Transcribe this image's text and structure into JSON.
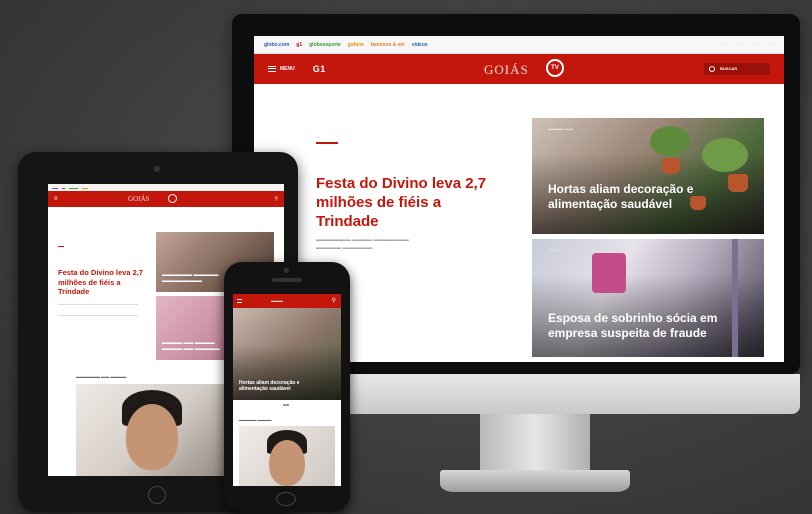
{
  "desktop": {
    "topbar": {
      "links": [
        {
          "label": "globo.com",
          "color": "#2b5fb3"
        },
        {
          "label": "g1",
          "color": "#c4170c"
        },
        {
          "label": "globoesporte",
          "color": "#3a9b2d"
        },
        {
          "label": "gshow",
          "color": "#f28b00"
        },
        {
          "label": "famosos & etc",
          "color": "#e67e22"
        },
        {
          "label": "vídeos",
          "color": "#2b5fb3"
        }
      ]
    },
    "header": {
      "menu_label": "MENU",
      "logo": "G1",
      "region": "GOIÁS",
      "tv_logo": "TV",
      "search_label": "BUSCAR",
      "brand_color": "#c4170c"
    },
    "main_story": {
      "headline": "Festa do Divino leva 2,7 milhões de fiéis a Trindade"
    },
    "cards": [
      {
        "title": "Hortas aliam decoração e alimentação saudável"
      },
      {
        "title": "Esposa de sobrinho sócia em empresa suspeita de fraude"
      }
    ]
  },
  "tablet": {
    "header": {
      "region": "GOIÁS"
    },
    "headline": "Festa do Divino leva 2,7 milhões de fiéis a Trindade"
  },
  "phone": {
    "card_title": "Hortas aliam decoração e alimentação saudável"
  }
}
